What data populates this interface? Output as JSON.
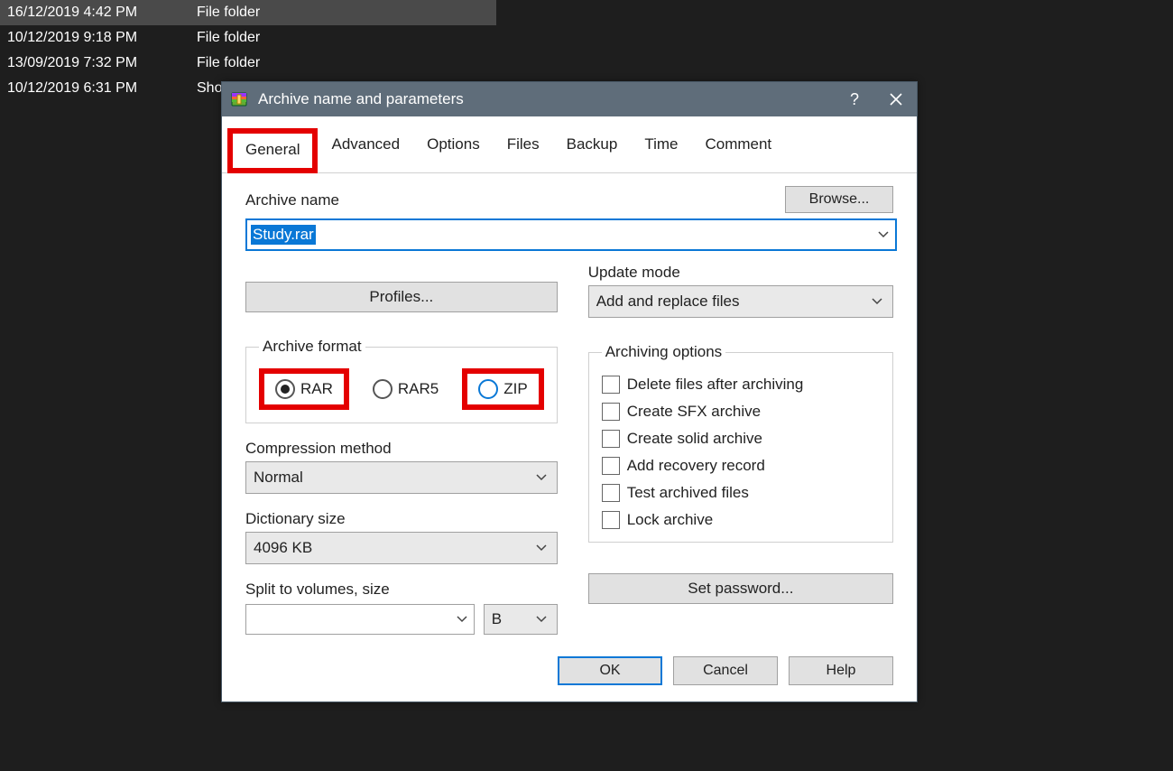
{
  "bg_rows": [
    {
      "date": "16/12/2019 4:42 PM",
      "type": "File folder",
      "selected": true
    },
    {
      "date": "10/12/2019 9:18 PM",
      "type": "File folder",
      "selected": false
    },
    {
      "date": "13/09/2019 7:32 PM",
      "type": "File folder",
      "selected": false
    },
    {
      "date": "10/12/2019 6:31 PM",
      "type": "Sho",
      "selected": false
    }
  ],
  "dialog": {
    "title": "Archive name and parameters",
    "tabs": [
      "General",
      "Advanced",
      "Options",
      "Files",
      "Backup",
      "Time",
      "Comment"
    ],
    "active_tab": 0,
    "archive_name_label": "Archive name",
    "archive_name_value": "Study.rar",
    "browse_label": "Browse...",
    "profiles_label": "Profiles...",
    "update_mode_label": "Update mode",
    "update_mode_value": "Add and replace files",
    "archive_format_label": "Archive format",
    "formats": [
      "RAR",
      "RAR5",
      "ZIP"
    ],
    "format_selected": 0,
    "compression_label": "Compression method",
    "compression_value": "Normal",
    "dictionary_label": "Dictionary size",
    "dictionary_value": "4096 KB",
    "split_label": "Split to volumes, size",
    "split_unit": "B",
    "archiving_options_label": "Archiving options",
    "archiving_options": [
      "Delete files after archiving",
      "Create SFX archive",
      "Create solid archive",
      "Add recovery record",
      "Test archived files",
      "Lock archive"
    ],
    "set_password_label": "Set password...",
    "ok": "OK",
    "cancel": "Cancel",
    "help": "Help"
  }
}
